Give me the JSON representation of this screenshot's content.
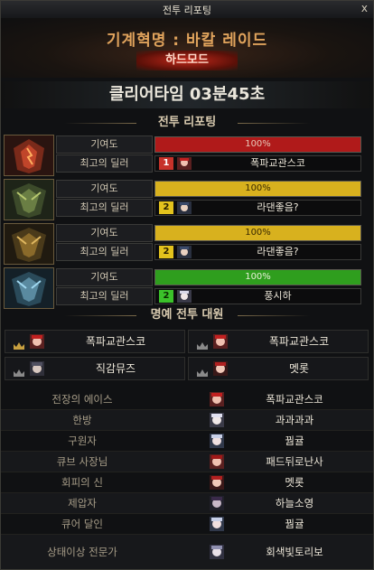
{
  "window": {
    "title": "전투 리포팅",
    "close_label": "x"
  },
  "header": {
    "raid_name": "기계혁명 : 바칼 레이드",
    "difficulty": "하드모드",
    "clear_time": "클리어타임  03분45초"
  },
  "sections": {
    "battle_report": "전투 리포팅",
    "honor": "명예 전투 대원"
  },
  "bosses": [
    {
      "contrib_label": "기여도",
      "contrib_value": "100%",
      "bar_color": "#b01a1a",
      "text_color": "#e8c8b8",
      "dealer_label": "최고의 딜러",
      "rank": "1",
      "rank_color": "#c7322a",
      "dealer": "폭파교관스코"
    },
    {
      "contrib_label": "기여도",
      "contrib_value": "100%",
      "bar_color": "#d8b11e",
      "text_color": "#3a2a00",
      "dealer_label": "최고의 딜러",
      "rank": "2",
      "rank_color": "#e3c31d",
      "dealer": "라댄좋음?"
    },
    {
      "contrib_label": "기여도",
      "contrib_value": "100%",
      "bar_color": "#d8b11e",
      "text_color": "#3a2a00",
      "dealer_label": "최고의 딜러",
      "rank": "2",
      "rank_color": "#e3c31d",
      "dealer": "라댄좋음?"
    },
    {
      "contrib_label": "기여도",
      "contrib_value": "100%",
      "bar_color": "#2f9e1e",
      "text_color": "#e8f0d8",
      "dealer_label": "최고의 딜러",
      "rank": "2",
      "rank_color": "#3bc22a",
      "dealer": "풍시하"
    }
  ],
  "honor": [
    {
      "name": "폭파교관스코"
    },
    {
      "name": "폭파교관스코"
    },
    {
      "name": "직감뮤즈"
    },
    {
      "name": "멧롯"
    }
  ],
  "titles": [
    {
      "title": "전장의 에이스",
      "name": "폭파교관스코"
    },
    {
      "title": "한방",
      "name": "과과과과"
    },
    {
      "title": "구원자",
      "name": "꿤귤"
    },
    {
      "title": "큐브 사장님",
      "name": "패드뒤로난사"
    },
    {
      "title": "회피의 신",
      "name": "멧롯"
    },
    {
      "title": "제압자",
      "name": "하늘소영"
    },
    {
      "title": "큐어 달인",
      "name": "꿤귤"
    },
    {
      "title": "상태이상 전문가",
      "name": "회색빛토리보"
    }
  ]
}
